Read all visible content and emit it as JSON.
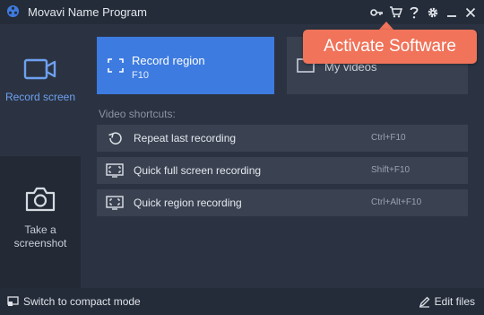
{
  "app": {
    "title": "Movavi Name Program",
    "logo_icon": "film-reel-icon",
    "titlebar_icons": [
      "key-icon",
      "cart-icon",
      "help-icon",
      "gear-icon",
      "minimize-icon",
      "close-icon"
    ]
  },
  "sidebar": {
    "items": [
      {
        "label": "Record screen",
        "icon": "camera-video-icon",
        "active": true
      },
      {
        "label": "Take a screenshot",
        "icon": "photo-camera-icon",
        "active": false
      }
    ]
  },
  "main": {
    "tiles": [
      {
        "title": "Record region",
        "shortcut": "F10",
        "icon": "region-brackets-icon"
      },
      {
        "title": "My videos",
        "icon": "folder-icon"
      }
    ],
    "shortcuts_label": "Video shortcuts:",
    "shortcuts": [
      {
        "label": "Repeat last recording",
        "key": "Ctrl+F10",
        "icon": "repeat-icon"
      },
      {
        "label": "Quick full screen recording",
        "key": "Shift+F10",
        "icon": "fullscreen-icon"
      },
      {
        "label": "Quick region recording",
        "key": "Ctrl+Alt+F10",
        "icon": "region-icon"
      }
    ]
  },
  "footer": {
    "compact_label": "Switch to compact mode",
    "edit_label": "Edit files"
  },
  "popup": {
    "text": "Activate Software"
  },
  "colors": {
    "accent": "#3d7be0",
    "active_text": "#6ea0f0",
    "popup": "#f0735a",
    "background": "#2b3342"
  }
}
